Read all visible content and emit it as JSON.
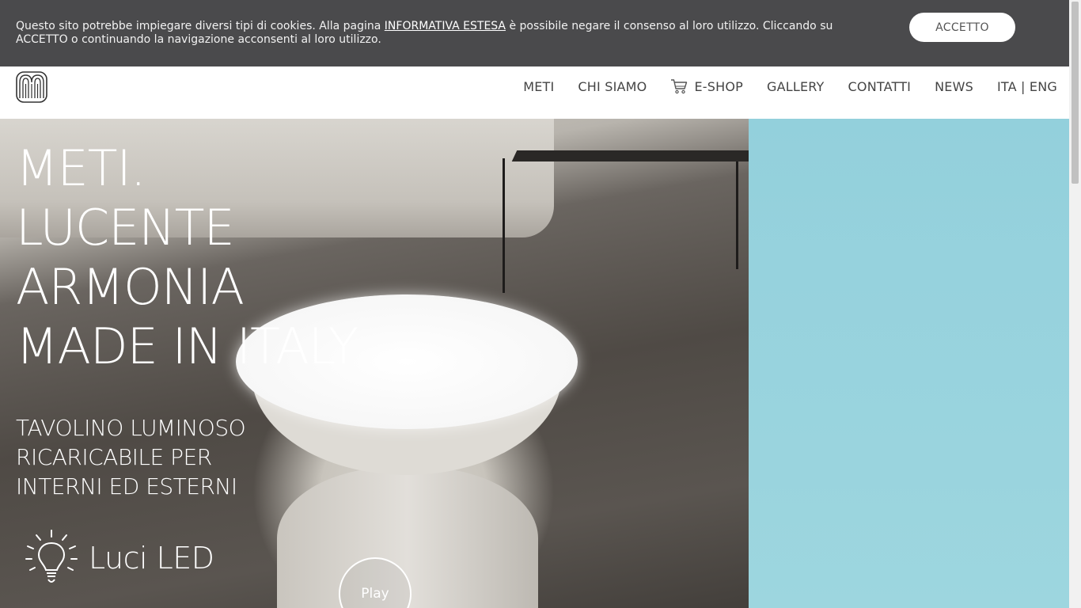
{
  "cookie_banner": {
    "text_before": "Questo sito potrebbe impiegare diversi tipi di cookies. Alla pagina ",
    "link": "INFORMATIVA ESTESA",
    "text_after": " è possibile negare il consenso al loro utilizzo. Cliccando su ACCETTO o continuando la navigazione acconsenti al loro utilizzo.",
    "accept_label": "ACCETTO"
  },
  "header": {
    "logo_icon": "meti-logo-icon",
    "nav": [
      {
        "label": "METI"
      },
      {
        "label": "CHI SIAMO"
      },
      {
        "label": "E-SHOP",
        "icon": "cart-icon"
      },
      {
        "label": "GALLERY"
      },
      {
        "label": "CONTATTI"
      },
      {
        "label": "NEWS"
      },
      {
        "label": "ITA | ENG"
      }
    ]
  },
  "hero": {
    "title_lines": [
      "METI.",
      "LUCENTE",
      "ARMONIA",
      "MADE IN ITALY"
    ],
    "subtitle_lines": [
      "TAVOLINO LUMINOSO",
      "RICARICABILE PER",
      "INTERNI ED ESTERNI"
    ],
    "feature_icon": "lightbulb-icon",
    "feature_label": "Luci LED",
    "play_label": "Play"
  },
  "colors": {
    "cookie_bg": "#4a4a4c",
    "side_panel": "#93d0dc",
    "nav_text": "#444444"
  }
}
